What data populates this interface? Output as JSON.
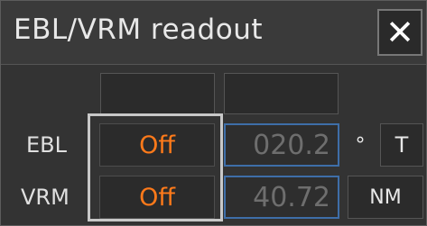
{
  "window": {
    "title": "EBL/VRM readout",
    "close_icon": "close-icon"
  },
  "rows": [
    {
      "label": "EBL",
      "state": "Off",
      "value": "020.2",
      "unit": "°",
      "unit_button": "T"
    },
    {
      "label": "VRM",
      "state": "Off",
      "value": "40.72",
      "unit_button": "NM"
    }
  ],
  "colors": {
    "off_text": "#ff7a1a",
    "readout_border": "#3e6ea8",
    "highlight": "#c8c8c8"
  }
}
